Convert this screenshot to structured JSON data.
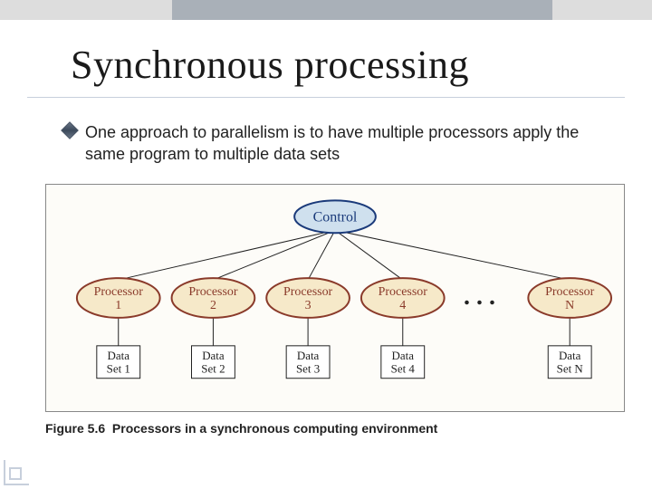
{
  "title": "Synchronous processing",
  "bullet": "One approach to parallelism is to have multiple processors apply the same program to multiple data sets",
  "caption": {
    "fig": "Figure 5.6",
    "desc": "Processors in a synchronous computing environment"
  },
  "diagram": {
    "control": "Control",
    "ellipsis": ". . .",
    "processors": [
      {
        "label1": "Processor",
        "label2": "1",
        "data1": "Data",
        "data2": "Set 1"
      },
      {
        "label1": "Processor",
        "label2": "2",
        "data1": "Data",
        "data2": "Set 2"
      },
      {
        "label1": "Processor",
        "label2": "3",
        "data1": "Data",
        "data2": "Set 3"
      },
      {
        "label1": "Processor",
        "label2": "4",
        "data1": "Data",
        "data2": "Set 4"
      },
      {
        "label1": "Processor",
        "label2": "N",
        "data1": "Data",
        "data2": "Set N"
      }
    ]
  }
}
